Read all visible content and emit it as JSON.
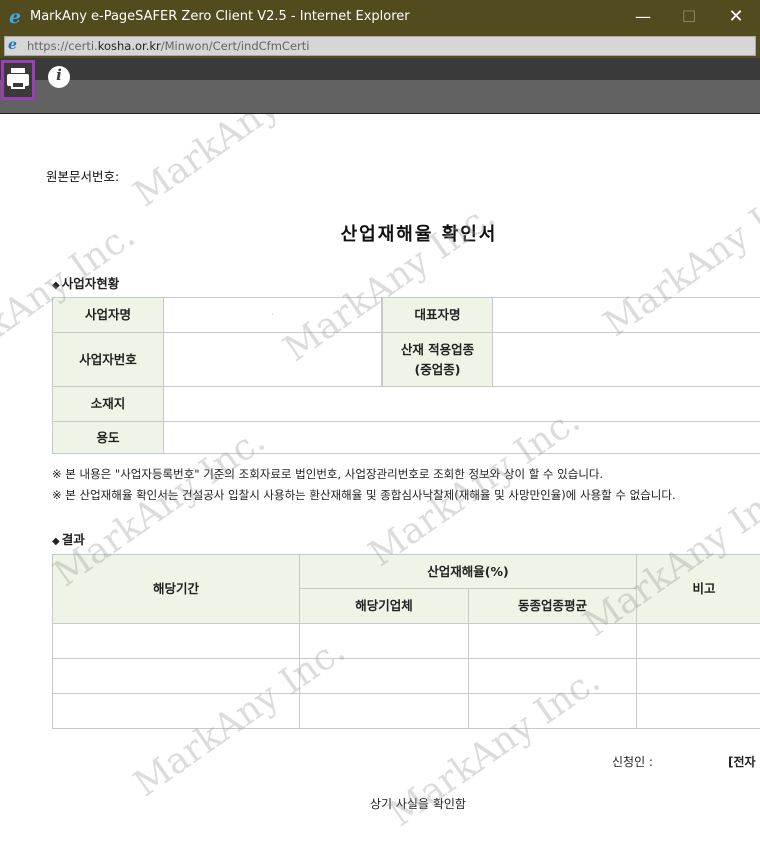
{
  "window": {
    "title": "MarkAny e-PageSAFER Zero Client V2.5 - Internet Explorer",
    "minimize": "—",
    "maximize": "☐",
    "close": "✕"
  },
  "address": {
    "prefix": "https://certi.",
    "domain": "kosha.or.kr",
    "path": "/Minwon/Cert/indCfmCerti"
  },
  "toolbar": {
    "print_icon": "printer-icon",
    "info_icon": "info-icon",
    "info_glyph": "i",
    "highlight_color": "#9b3fb4"
  },
  "document": {
    "doc_number_label": "원본문서번호:",
    "title": "산업재해율 확인서",
    "section_business": "사업자현황",
    "section_result": "결과",
    "section_marker": "◆",
    "business_table": {
      "business_name": "사업자명",
      "representative": "대표자명",
      "business_number": "사업자번호",
      "industry_type_line1": "산재 적용업종",
      "industry_type_line2": "(중업종)",
      "address": "소재지",
      "usage": "용도"
    },
    "notes": [
      "※ 본 내용은 \"사업자등록번호\" 기준의 조회자료로 법인번호, 사업장관리번호로 조회한 정보와 상이 할 수 있습니다.",
      "※ 본 산업재해율 확인서는 건설공사 입찰시 사용하는 환산재해율 및 종합심사낙찰제(재해율 및 사망만인율)에 사용할 수 없습니다."
    ],
    "result_table": {
      "period": "해당기간",
      "accident_rate": "산업재해율(%)",
      "company": "해당기업체",
      "industry_avg": "동종업종평균",
      "remarks": "비고"
    },
    "applicant_label": "신청인 :",
    "applicant_value": "[전자",
    "confirm_text": "상기 사실을 확인함"
  },
  "watermark": {
    "text": "MarkAny Inc.",
    "color": "rgba(150,150,150,0.33)"
  }
}
